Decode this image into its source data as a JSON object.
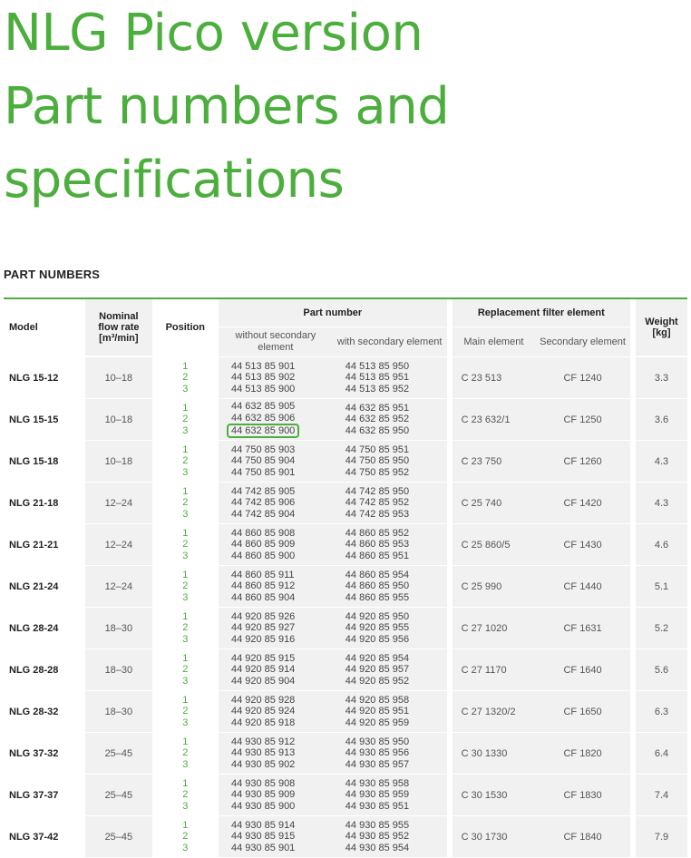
{
  "title": {
    "line1": "NLG Pico version",
    "line2": "Part numbers and",
    "line3": "specifications"
  },
  "section_heading": "PART NUMBERS",
  "table": {
    "headers": {
      "model": "Model",
      "flow_line1": "Nominal",
      "flow_line2": "flow rate",
      "flow_line3": "[m³/min]",
      "position": "Position",
      "part_number": "Part number",
      "without_secondary": "without secondary element",
      "with_secondary": "with secondary element",
      "replacement": "Replacement filter element",
      "main_element": "Main element",
      "secondary_element": "Secondary element",
      "weight_line1": "Weight",
      "weight_line2": "[kg]"
    },
    "rows": [
      {
        "model": "NLG 15-12",
        "flow": "10–18",
        "positions": [
          "1",
          "2",
          "3"
        ],
        "without": [
          "44 513 85 901",
          "44 513 85 902",
          "44 513 85 900"
        ],
        "with": [
          "44 513 85 950",
          "44 513 85 951",
          "44 513 85 952"
        ],
        "main": "C 23 513",
        "secondary": "CF 1240",
        "weight": "3.3"
      },
      {
        "model": "NLG 15-15",
        "flow": "10–18",
        "positions": [
          "1",
          "2",
          "3"
        ],
        "without": [
          "44 632 85 905",
          "44 632 85 906",
          "44 632 85 900"
        ],
        "with": [
          "44 632 85 951",
          "44 632 85 952",
          "44 632 85 950"
        ],
        "main": "C 23 632/1",
        "secondary": "CF 1250",
        "weight": "3.6"
      },
      {
        "model": "NLG 15-18",
        "flow": "10–18",
        "positions": [
          "1",
          "2",
          "3"
        ],
        "without": [
          "44 750 85 903",
          "44 750 85 904",
          "44 750 85 901"
        ],
        "with": [
          "44 750 85 951",
          "44 750 85 950",
          "44 750 85 952"
        ],
        "main": "C 23 750",
        "secondary": "CF 1260",
        "weight": "4.3"
      },
      {
        "model": "NLG 21-18",
        "flow": "12–24",
        "positions": [
          "1",
          "2",
          "3"
        ],
        "without": [
          "44 742 85 905",
          "44 742 85 906",
          "44 742 85 904"
        ],
        "with": [
          "44 742 85 950",
          "44 742 85 952",
          "44 742 85 953"
        ],
        "main": "C 25 740",
        "secondary": "CF 1420",
        "weight": "4.3"
      },
      {
        "model": "NLG 21-21",
        "flow": "12–24",
        "positions": [
          "1",
          "2",
          "3"
        ],
        "without": [
          "44 860 85 908",
          "44 860 85 909",
          "44 860 85 900"
        ],
        "with": [
          "44 860 85 952",
          "44 860 85 953",
          "44 860 85 951"
        ],
        "main": "C 25 860/5",
        "secondary": "CF 1430",
        "weight": "4.6"
      },
      {
        "model": "NLG 21-24",
        "flow": "12–24",
        "positions": [
          "1",
          "2",
          "3"
        ],
        "without": [
          "44 860 85 911",
          "44 860 85 912",
          "44 860 85 904"
        ],
        "with": [
          "44 860 85 954",
          "44 860 85 950",
          "44 860 85 955"
        ],
        "main": "C 25 990",
        "secondary": "CF 1440",
        "weight": "5.1"
      },
      {
        "model": "NLG 28-24",
        "flow": "18–30",
        "positions": [
          "1",
          "2",
          "3"
        ],
        "without": [
          "44 920 85 926",
          "44 920 85 927",
          "44 920 85 916"
        ],
        "with": [
          "44 920 85 950",
          "44 920 85 955",
          "44 920 85 956"
        ],
        "main": "C 27 1020",
        "secondary": "CF 1631",
        "weight": "5.2"
      },
      {
        "model": "NLG 28-28",
        "flow": "18–30",
        "positions": [
          "1",
          "2",
          "3"
        ],
        "without": [
          "44 920 85 915",
          "44 920 85 914",
          "44 920 85 904"
        ],
        "with": [
          "44 920 85 954",
          "44 920 85 957",
          "44 920 85 952"
        ],
        "main": "C 27 1170",
        "secondary": "CF 1640",
        "weight": "5.6"
      },
      {
        "model": "NLG 28-32",
        "flow": "18–30",
        "positions": [
          "1",
          "2",
          "3"
        ],
        "without": [
          "44 920 85 928",
          "44 920 85 924",
          "44 920 85 918"
        ],
        "with": [
          "44 920 85 958",
          "44 920 85 951",
          "44 920 85 959"
        ],
        "main": "C 27 1320/2",
        "secondary": "CF 1650",
        "weight": "6.3"
      },
      {
        "model": "NLG 37-32",
        "flow": "25–45",
        "positions": [
          "1",
          "2",
          "3"
        ],
        "without": [
          "44 930 85 912",
          "44 930 85 913",
          "44 930 85 902"
        ],
        "with": [
          "44 930 85 950",
          "44 930 85 956",
          "44 930 85 957"
        ],
        "main": "C 30 1330",
        "secondary": "CF 1820",
        "weight": "6.4"
      },
      {
        "model": "NLG 37-37",
        "flow": "25–45",
        "positions": [
          "1",
          "2",
          "3"
        ],
        "without": [
          "44 930 85 908",
          "44 930 85 909",
          "44 930 85 900"
        ],
        "with": [
          "44 930 85 958",
          "44 930 85 959",
          "44 930 85 951"
        ],
        "main": "C 30 1530",
        "secondary": "CF 1830",
        "weight": "7.4"
      },
      {
        "model": "NLG 37-42",
        "flow": "25–45",
        "positions": [
          "1",
          "2",
          "3"
        ],
        "without": [
          "44 930 85 914",
          "44 930 85 915",
          "44 930 85 901"
        ],
        "with": [
          "44 930 85 955",
          "44 930 85 952",
          "44 930 85 954"
        ],
        "main": "C 30 1730",
        "secondary": "CF 1840",
        "weight": "7.9"
      }
    ],
    "highlight": {
      "row": 1,
      "line": 2
    }
  },
  "colors": {
    "brand_green": "#4cae3d",
    "cell_shade": "#f1f1f1"
  }
}
